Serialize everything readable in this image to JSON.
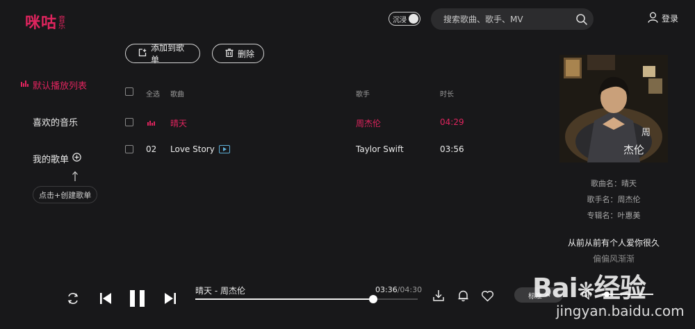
{
  "header": {
    "logo_main": "咪咕",
    "logo_sub": "音乐",
    "immersive_label": "沉浸",
    "search_placeholder": "搜索歌曲、歌手、MV",
    "login_label": "登录"
  },
  "toolbar": {
    "add_label": "添加到歌单",
    "delete_label": "删除"
  },
  "sidebar": {
    "items": [
      {
        "label": "默认播放列表"
      },
      {
        "label": "喜欢的音乐"
      },
      {
        "label": "我的歌单"
      }
    ],
    "create_label": "点击+创建歌单"
  },
  "table": {
    "headers": {
      "select_all": "全选",
      "song": "歌曲",
      "singer": "歌手",
      "duration": "时长"
    },
    "rows": [
      {
        "index": "",
        "title": "晴天",
        "singer": "周杰伦",
        "duration": "04:29",
        "playing": true
      },
      {
        "index": "02",
        "title": "Love Story",
        "singer": "Taylor Swift",
        "duration": "03:56",
        "playing": false
      }
    ]
  },
  "now_playing": {
    "song_name": "歌曲名：晴天",
    "singer_name": "歌手名：周杰伦",
    "album_name": "专辑名：叶惠美",
    "lyric_current": "从前从前有个人爱你很久",
    "lyric_next": "偏偏风渐渐",
    "cover_text": "周\n杰伦"
  },
  "player": {
    "track_label": "晴天 - 周杰伦",
    "elapsed": "03:36",
    "total": "/04:30",
    "progress": 0.8,
    "quality_label": "标准",
    "volume": 0.1
  },
  "watermark": {
    "brand": "Bai",
    "brand_cn": "经验",
    "url": "jingyan.baidu.com"
  },
  "colors": {
    "accent": "#e0245e",
    "background": "#18181a",
    "mv_icon": "#5fb0d9"
  }
}
